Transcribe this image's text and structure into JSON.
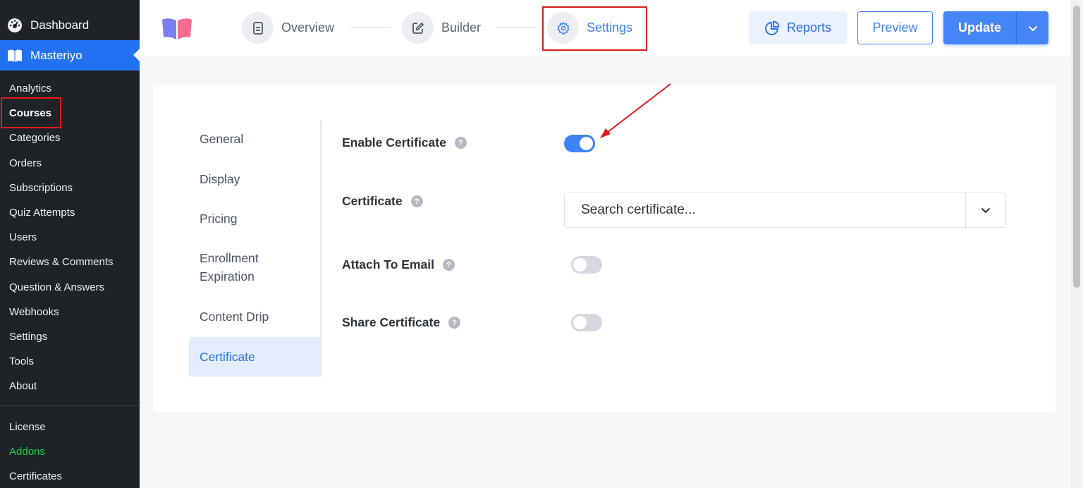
{
  "sidebar": {
    "dashboard_label": "Dashboard",
    "active_label": "Masteriyo",
    "items": [
      {
        "label": "Analytics"
      },
      {
        "label": "Courses"
      },
      {
        "label": "Categories"
      },
      {
        "label": "Orders"
      },
      {
        "label": "Subscriptions"
      },
      {
        "label": "Quiz Attempts"
      },
      {
        "label": "Users"
      },
      {
        "label": "Reviews & Comments"
      },
      {
        "label": "Question & Answers"
      },
      {
        "label": "Webhooks"
      },
      {
        "label": "Settings"
      },
      {
        "label": "Tools"
      },
      {
        "label": "About"
      }
    ],
    "items2": [
      {
        "label": "License"
      },
      {
        "label": "Addons"
      },
      {
        "label": "Certificates"
      }
    ]
  },
  "header": {
    "steps": [
      {
        "label": "Overview"
      },
      {
        "label": "Builder"
      },
      {
        "label": "Settings"
      }
    ],
    "reports_label": "Reports",
    "preview_label": "Preview",
    "update_label": "Update"
  },
  "settings": {
    "tabs": [
      {
        "label": "General"
      },
      {
        "label": "Display"
      },
      {
        "label": "Pricing"
      },
      {
        "label": "Enrollment Expiration"
      },
      {
        "label": "Content Drip"
      },
      {
        "label": "Certificate"
      }
    ],
    "enable_certificate": {
      "label": "Enable Certificate",
      "enabled": true
    },
    "certificate": {
      "label": "Certificate",
      "placeholder": "Search certificate..."
    },
    "attach_to_email": {
      "label": "Attach To Email",
      "enabled": false
    },
    "share_certificate": {
      "label": "Share Certificate",
      "enabled": false
    },
    "help_glyph": "?"
  },
  "colors": {
    "accent": "#3e82f6",
    "sidebar_bg": "#1d2327",
    "highlight": "#e01b1b",
    "addons_green": "#1ed14b"
  }
}
